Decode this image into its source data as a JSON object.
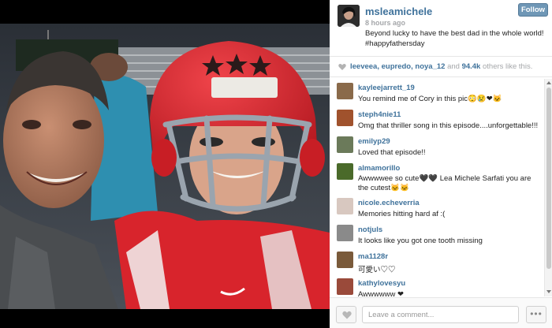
{
  "post": {
    "username": "msleamichele",
    "time": "8 hours ago",
    "caption": "Beyond lucky to have the best dad in the whole world! #happyfathersday",
    "follow_label": "Follow"
  },
  "likes": {
    "users": [
      "leeveea",
      "eupredo",
      "noya_12"
    ],
    "and_text": "and",
    "count": "94.4k",
    "rest": "others like this."
  },
  "comments": [
    {
      "user": "kayleejarrett_19",
      "text": "You remind me of Cory in this pic😳😢❤🐱",
      "avatar_color": "#8a6a4a"
    },
    {
      "user": "steph4nie11",
      "text": "Omg that thriller song in this episode....unforgettable!!!",
      "avatar_color": "#a0522d"
    },
    {
      "user": "emilyp29",
      "text": "Loved that episode!!",
      "avatar_color": "#6b7a5a"
    },
    {
      "user": "almamorillo",
      "text": "Awwwwee so cute🖤🖤 Lea Michele Sarfati you are the cutest🐱🐱",
      "avatar_color": "#4a6a2a"
    },
    {
      "user": "nicole.echeverria",
      "text": "Memories hitting hard af :(",
      "avatar_color": "#d8c8c0"
    },
    {
      "user": "notjuls",
      "text": "It looks like you got one tooth missing",
      "avatar_color": "#8a8a8a"
    },
    {
      "user": "ma1128r",
      "text": "可愛い♡♡",
      "avatar_color": "#7a5a3a"
    },
    {
      "user": "kathylovesyu",
      "text": "Awwwwww ❤",
      "avatar_color": "#9a4a3a"
    }
  ],
  "footer": {
    "comment_placeholder": "Leave a comment...",
    "more_label": "•••"
  },
  "icons": {
    "like": "heart-icon",
    "more": "ellipsis-icon"
  },
  "colors": {
    "link": "#3f729b",
    "follow_button": "#6f97b6",
    "jersey_red": "#d8242c"
  }
}
